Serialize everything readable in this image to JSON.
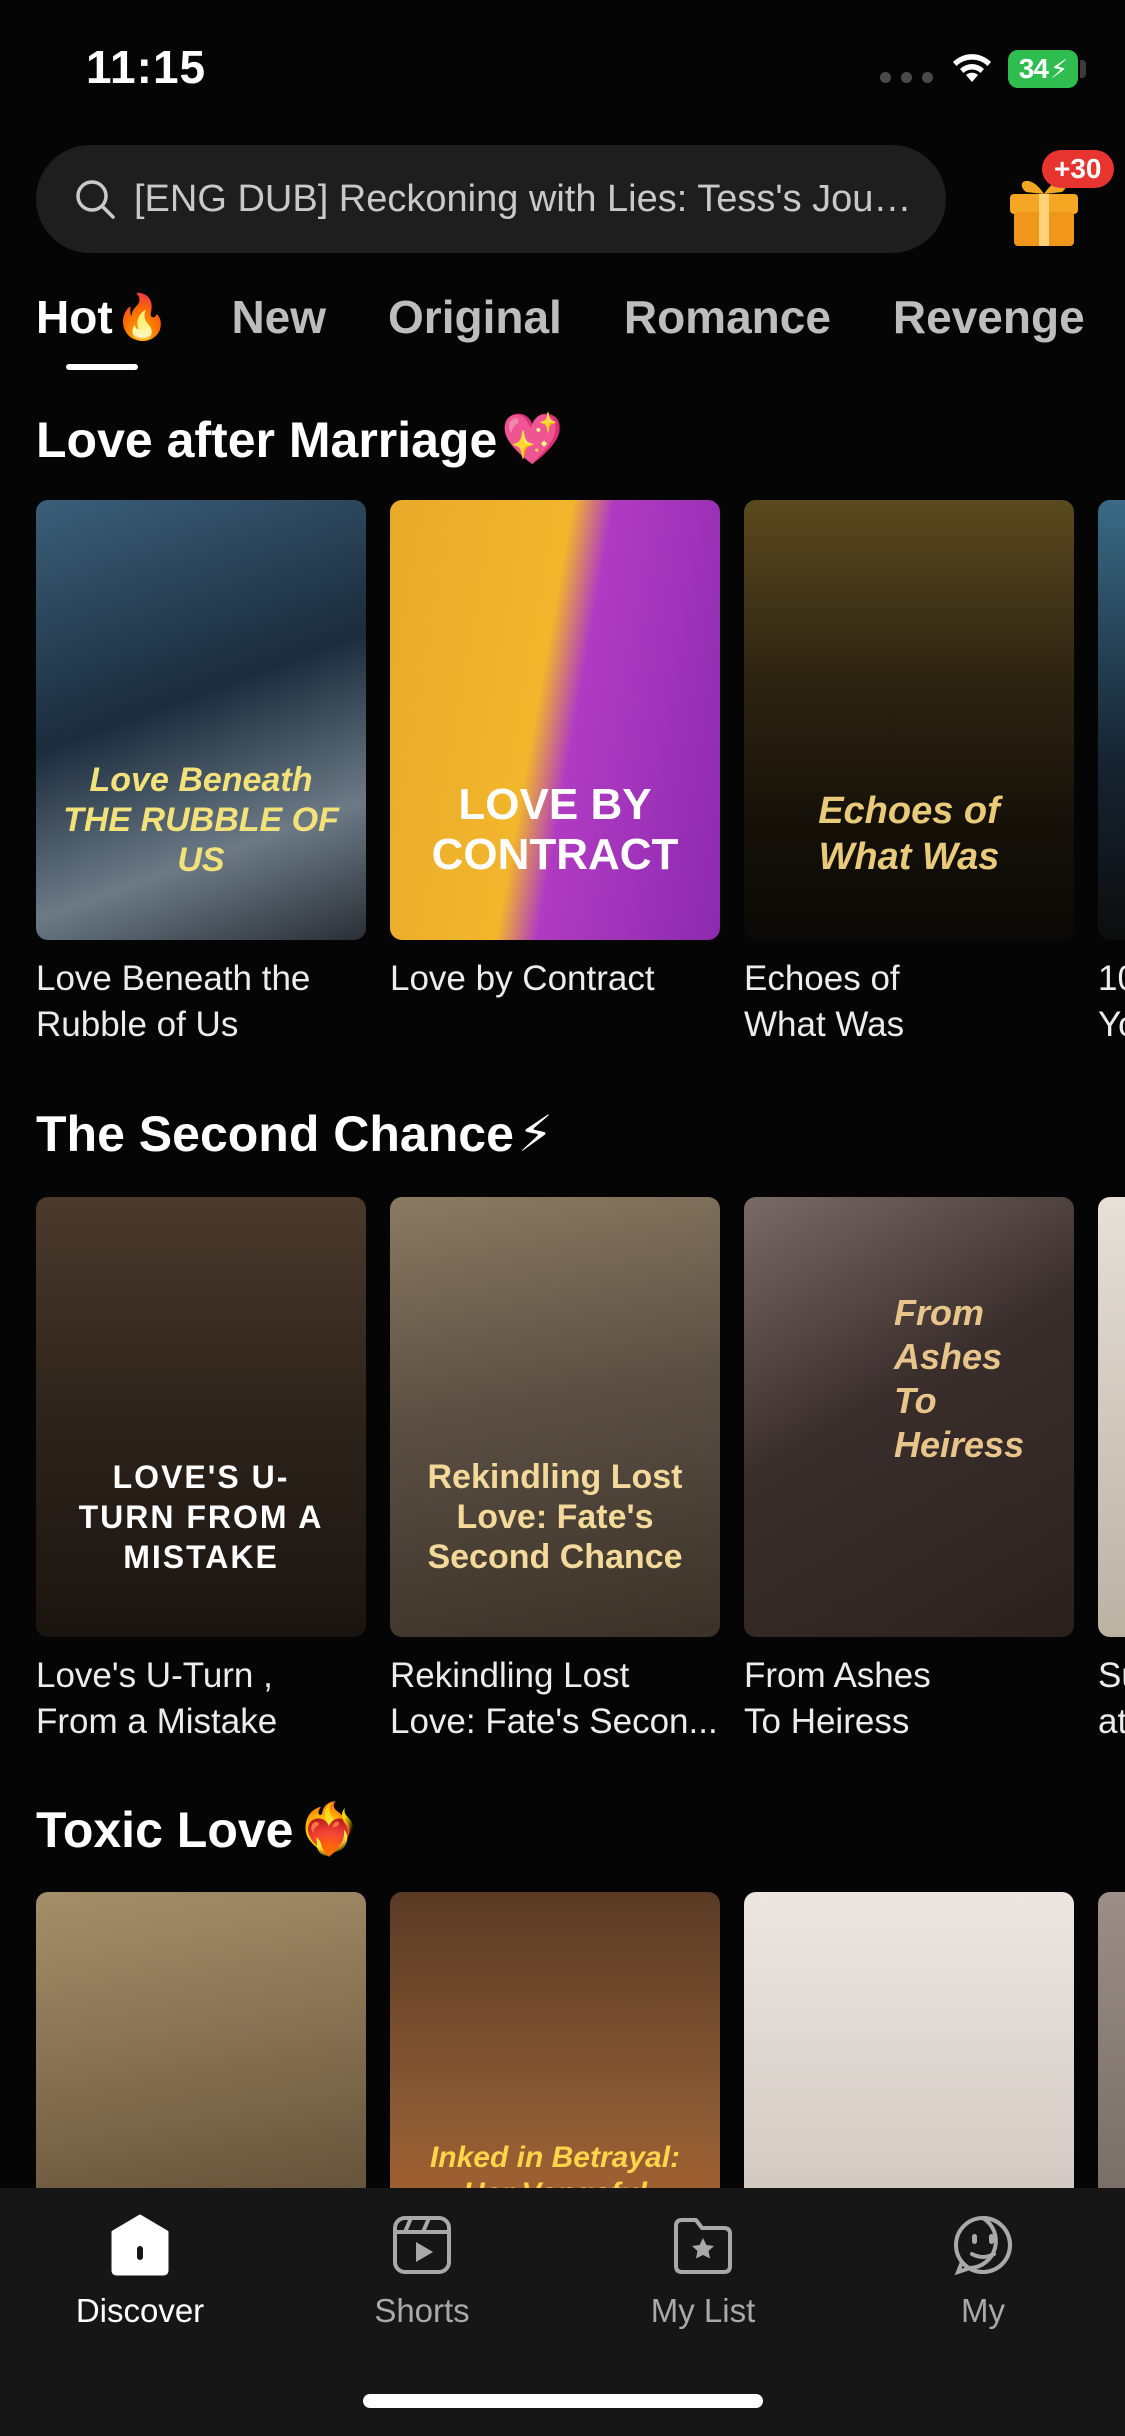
{
  "status": {
    "time": "11:15",
    "battery": "34"
  },
  "search": {
    "placeholder": "[ENG DUB] Reckoning with Lies: Tess's Jour..."
  },
  "gift": {
    "badge": "+30"
  },
  "tabs": [
    {
      "label": "Hot",
      "emoji": "🔥"
    },
    {
      "label": "New"
    },
    {
      "label": "Original"
    },
    {
      "label": "Romance"
    },
    {
      "label": "Revenge"
    }
  ],
  "sections": [
    {
      "title": "Love after Marriage",
      "emoji": "💖",
      "cards": [
        {
          "line1": "Love Beneath the",
          "line2": "Rubble of Us",
          "poster_text": "Love Beneath THE RUBBLE OF US"
        },
        {
          "line1": "Love by Contract",
          "line2": "",
          "poster_text": "LOVE BY CONTRACT"
        },
        {
          "line1": "Echoes of",
          "line2": "What Was",
          "poster_text": "Echoes of What Was"
        },
        {
          "line1": "10",
          "line2": "Yo",
          "poster_text": ""
        }
      ]
    },
    {
      "title": "The Second Chance",
      "emoji": "⚡",
      "cards": [
        {
          "line1": "Love's U-Turn ,",
          "line2": "From a Mistake",
          "poster_text": "LOVE'S U-TURN FROM A MISTAKE"
        },
        {
          "line1": "Rekindling Lost",
          "line2": "Love: Fate's Secon...",
          "poster_text": "Rekindling Lost Love: Fate's Second Chance"
        },
        {
          "line1": "From Ashes",
          "line2": "To Heiress",
          "poster_text": "From Ashes To Heiress"
        },
        {
          "line1": "Su",
          "line2": "at",
          "poster_text": ""
        }
      ]
    },
    {
      "title": "Toxic Love",
      "emoji": "❤️‍🔥",
      "cards": [
        {
          "line1": "",
          "line2": "",
          "poster_text": ""
        },
        {
          "line1": "",
          "line2": "",
          "poster_text": "Inked in Betrayal: Her Vengeful"
        },
        {
          "line1": "",
          "line2": "",
          "poster_text": ""
        },
        {
          "line1": "",
          "line2": "",
          "poster_text": ""
        }
      ]
    }
  ],
  "nav": [
    {
      "label": "Discover",
      "icon": "discover-icon"
    },
    {
      "label": "Shorts",
      "icon": "shorts-icon"
    },
    {
      "label": "My List",
      "icon": "my-list-icon"
    },
    {
      "label": "My",
      "icon": "profile-icon"
    }
  ],
  "colors": {
    "background": "#050505",
    "search_bg": "#1e1e1e",
    "tabbar_bg": "#161616",
    "badge": "#e8342f",
    "battery": "#2fbd4f",
    "gift": "#f5a623"
  }
}
